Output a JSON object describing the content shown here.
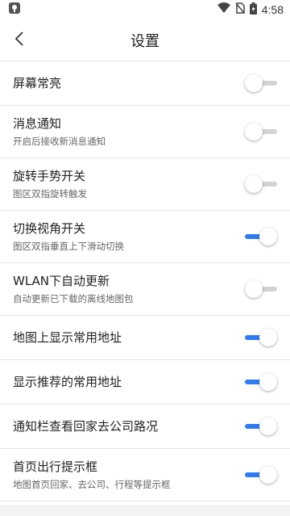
{
  "status_bar": {
    "time": "4:58",
    "icons": [
      "app-notification-icon",
      "wifi-icon",
      "no-sim-icon",
      "battery-icon"
    ]
  },
  "header": {
    "title": "设置",
    "back_icon": "chevron-left-icon"
  },
  "colors": {
    "accent": "#2f7bf5",
    "toggle_off": "#d3d3d3",
    "divider": "#e6e6e6"
  },
  "settings": [
    {
      "label": "屏幕常亮",
      "sub": "",
      "enabled": false
    },
    {
      "label": "消息通知",
      "sub": "开启后接收新消息通知",
      "enabled": false
    },
    {
      "label": "旋转手势开关",
      "sub": "图区双指旋转触发",
      "enabled": false
    },
    {
      "label": "切换视角开关",
      "sub": "图区双指垂直上下滑动切换",
      "enabled": true
    },
    {
      "label": "WLAN下自动更新",
      "sub": "自动更新已下载的离线地图包",
      "enabled": false
    },
    {
      "label": "地图上显示常用地址",
      "sub": "",
      "enabled": true
    },
    {
      "label": "显示推荐的常用地址",
      "sub": "",
      "enabled": true
    },
    {
      "label": "通知栏查看回家去公司路况",
      "sub": "",
      "enabled": true
    },
    {
      "label": "首页出行提示框",
      "sub": "地图首页回家、去公司、行程等提示框",
      "enabled": true
    }
  ]
}
